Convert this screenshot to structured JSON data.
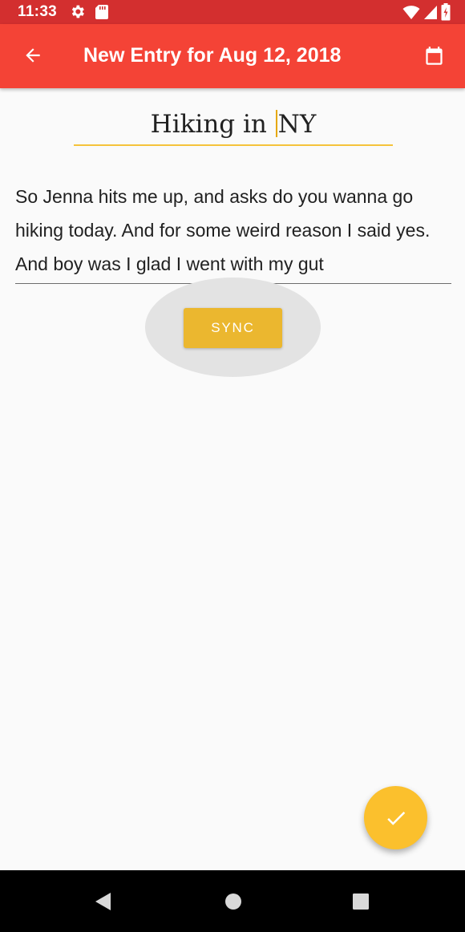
{
  "status_bar": {
    "time": "11:33",
    "icons": [
      "gear-icon",
      "sd-card-icon",
      "wifi-icon",
      "signal-icon",
      "battery-icon"
    ]
  },
  "app_bar": {
    "title": "New Entry for Aug 12, 2018",
    "back_icon": "arrow-back-icon",
    "calendar_icon": "calendar-icon",
    "color": "#f44336"
  },
  "entry": {
    "title_before_cursor": "Hiking in ",
    "title_after_cursor": "NY",
    "body": "So Jenna hits me up, and asks do you wanna go hiking today. And for some weird reason I said yes. And boy was I glad I went with my gut"
  },
  "sync_button": {
    "label": "SYNC",
    "color": "#ebb72f"
  },
  "fab": {
    "icon": "check-icon",
    "color": "#fbc02d"
  },
  "nav_bar": {
    "icons": [
      "back-triangle-icon",
      "home-circle-icon",
      "recents-square-icon"
    ]
  }
}
